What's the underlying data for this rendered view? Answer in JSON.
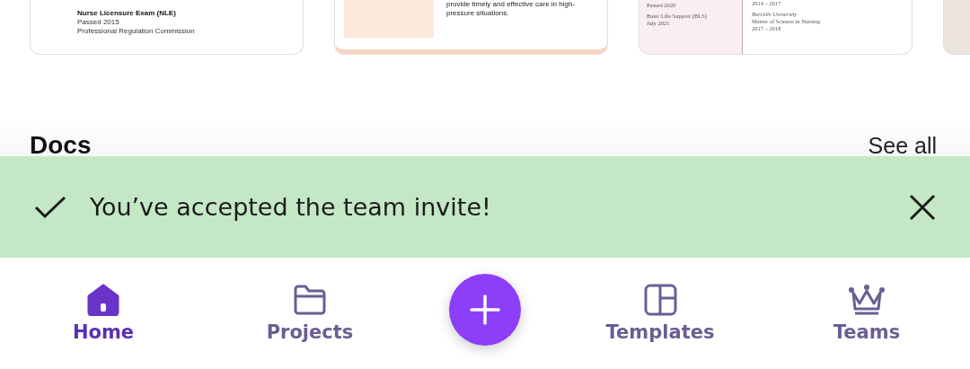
{
  "designs": [
    {
      "kind": "certificates",
      "lines": [
        {
          "text": "Nurse Licensure Exam (NLE)",
          "bold": true
        },
        {
          "text": "Passed 2015",
          "bold": false
        },
        {
          "text": "Professional Regulation Commission",
          "bold": false
        }
      ]
    },
    {
      "kind": "summary",
      "text": "provide timely and effective care in high-pressure situations."
    },
    {
      "kind": "two-column",
      "left": [
        "Passed 2020",
        "Basic Life Support (BLS)",
        "July 2021"
      ],
      "right": [
        {
          "text": "2014 – 2017",
          "italic": false
        },
        {
          "text": "Borcelle University",
          "italic": true
        },
        {
          "text": "Master of Science in Nursing",
          "italic": false
        },
        {
          "text": "2017 – 2018",
          "italic": false
        }
      ]
    },
    {
      "kind": "blank"
    }
  ],
  "section": {
    "title": "Docs",
    "link": "See all"
  },
  "toast": {
    "message": "You’ve accepted the team invite!"
  },
  "nav": [
    {
      "label": "Home",
      "kind": "home",
      "selected": true
    },
    {
      "label": "Projects",
      "kind": "folder",
      "selected": false
    },
    {
      "label": "Templates",
      "kind": "layout",
      "selected": false
    },
    {
      "label": "Teams",
      "kind": "crown",
      "selected": false
    }
  ]
}
